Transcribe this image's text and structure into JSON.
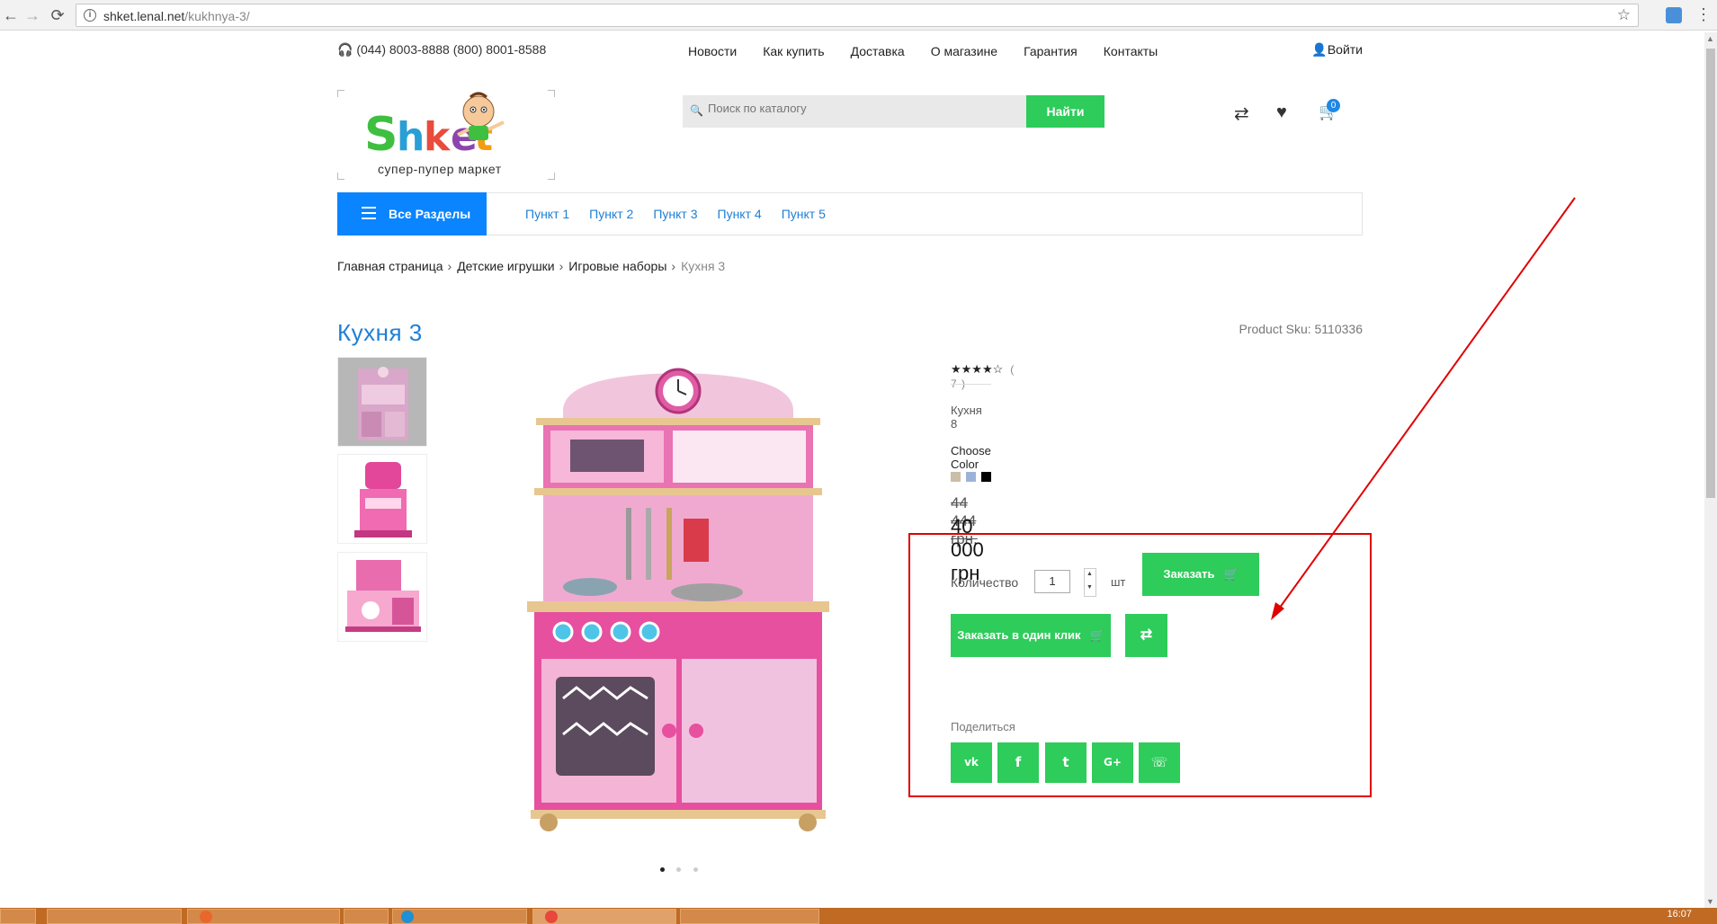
{
  "browser": {
    "url_host": "shket.lenal.net",
    "url_path": "/kukhnya-3/",
    "back": "←",
    "forward": "→",
    "reload": "⟳",
    "info": "i",
    "star": "☆",
    "menu": "⋮"
  },
  "topbar": {
    "phones": "🎧 (044) 8003-8888   (800) 8001-8588",
    "menu": [
      "Новости",
      "Как купить",
      "Доставка",
      "О магазине",
      "Гарантия",
      "Контакты"
    ],
    "login": "👤Войти"
  },
  "logo": {
    "brand": "Shket",
    "tagline": "супер-пупер маркет"
  },
  "search": {
    "placeholder": "Поиск по каталогу",
    "button": "Найти"
  },
  "header_icons": {
    "compare": "⇄",
    "wishlist": "♥",
    "cart": "🛒",
    "cart_count": "0"
  },
  "catbar": {
    "all_sections": "Все Разделы",
    "links": [
      "Пункт 1",
      "Пункт 2",
      "Пункт 3",
      "Пункт 4",
      "Пункт 5"
    ]
  },
  "breadcrumb": {
    "items": [
      "Главная страница",
      "Детские игрушки",
      "Игровые наборы"
    ],
    "current": "Кухня 3",
    "sep": "›"
  },
  "product": {
    "title": "Кухня  3",
    "sku": "Product Sku: 5110336",
    "rating_stars": "★★★★☆",
    "rating_value": 4,
    "rating_count": "( 7 )",
    "model": "Кухня 8",
    "choose_color": "Choose Color",
    "colors": [
      "#cbbfa8",
      "#9cb3d9",
      "#000000"
    ],
    "old_price": "44 444 грн.",
    "new_price": "40 000 грн",
    "qty_label": "Количество",
    "qty_value": "1",
    "qty_unit": "шт",
    "order_button": "Заказать",
    "one_click_button": "Заказать в один клик",
    "compare_button": "⇄",
    "share_label": "Поделиться",
    "share_buttons": [
      "vk",
      "f",
      "t",
      "G+",
      "☏"
    ],
    "slider_dots": 3,
    "slider_active": 1
  },
  "colors": {
    "green": "#2ecc5a",
    "blue": "#0a84ff",
    "link_blue": "#1e7fd6",
    "annotation_red": "#e00000"
  },
  "taskbar": {
    "clock": "16:07"
  }
}
